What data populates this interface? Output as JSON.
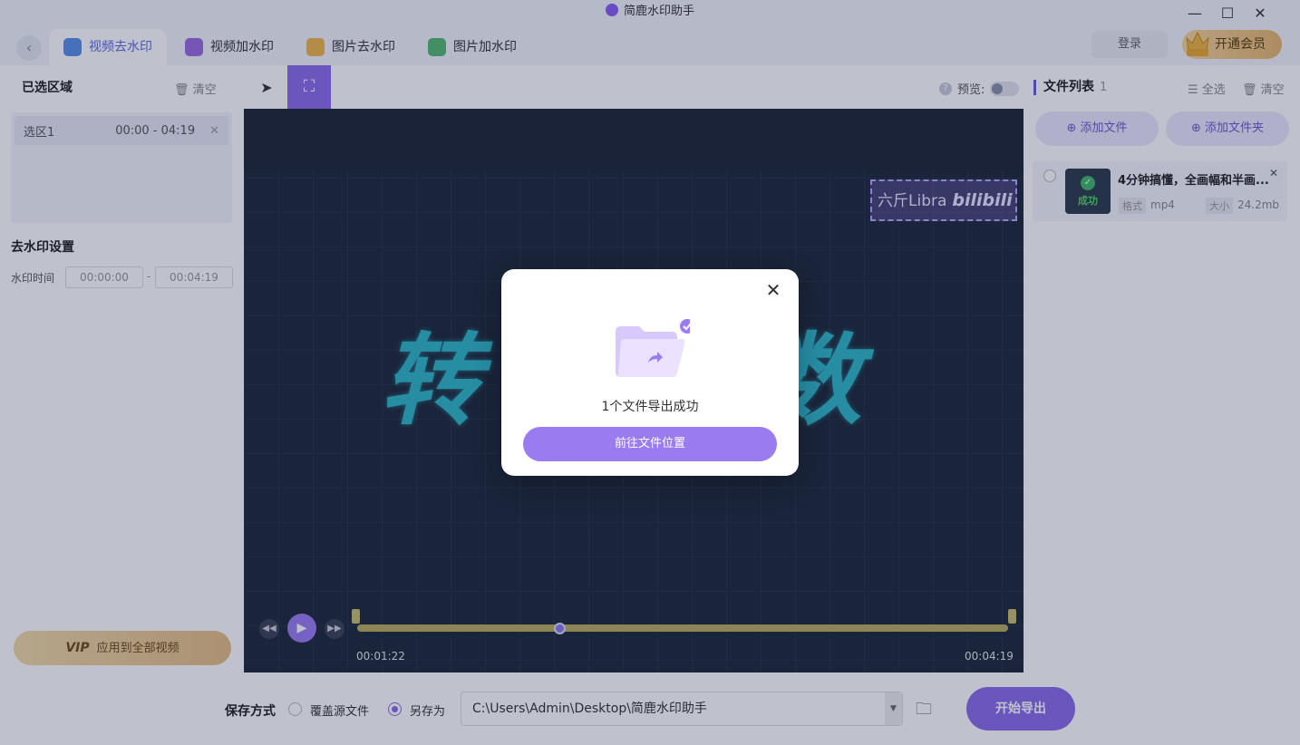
{
  "window": {
    "title": "简鹿水印助手",
    "minimize": "—",
    "maximize": "☐",
    "close": "✕"
  },
  "tabs": [
    {
      "label": "视频去水印",
      "active": true,
      "color": "#5b8fe6"
    },
    {
      "label": "视频加水印",
      "active": false,
      "color": "#9b6ae0"
    },
    {
      "label": "图片去水印",
      "active": false,
      "color": "#f0b64a"
    },
    {
      "label": "图片加水印",
      "active": false,
      "color": "#55b86f"
    }
  ],
  "header": {
    "login": "登录",
    "vip": "开通会员"
  },
  "left_panel": {
    "selected_title": "已选区域",
    "clear": "清空",
    "selection": {
      "name": "选区1",
      "range": "00:00 - 04:19"
    },
    "settings_title": "去水印设置",
    "time_label": "水印时间",
    "time_start": "00:00:00",
    "time_sep": "-",
    "time_end": "00:04:19",
    "apply_vip": "VIP",
    "apply_label": "应用到全部视频"
  },
  "toolbar": {
    "preview_label": "预览:"
  },
  "video": {
    "title_text": "转换倍数",
    "watermark_text": "六斤Libra",
    "watermark_brand": "bilibili",
    "current_time": "00:01:22",
    "total_time": "00:04:19",
    "progress": 0.31
  },
  "right_panel": {
    "title": "文件列表",
    "count": "1",
    "select_all": "全选",
    "clear": "清空",
    "add_file": "添加文件",
    "add_folder": "添加文件夹",
    "file": {
      "name": "4分钟搞懂，全画幅和半画...",
      "status": "成功",
      "format_label": "格式",
      "format": "mp4",
      "size_label": "大小",
      "size": "24.2mb"
    }
  },
  "save_bar": {
    "label": "保存方式",
    "option_overwrite": "覆盖源文件",
    "option_save_as": "另存为",
    "path": "C:\\Users\\Admin\\Desktop\\简鹿水印助手",
    "export": "开始导出"
  },
  "modal": {
    "message": "1个文件导出成功",
    "button": "前往文件位置"
  }
}
